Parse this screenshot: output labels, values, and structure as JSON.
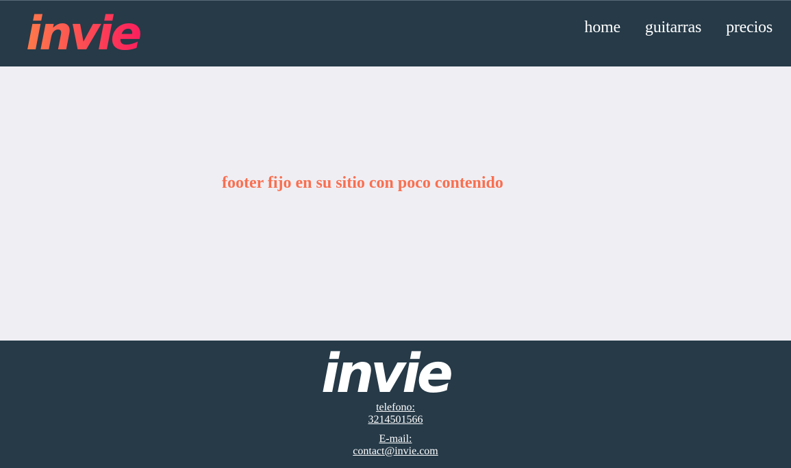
{
  "brand": {
    "name": "invie",
    "header_logo_gradient": [
      "#fd7a4a",
      "#fb1f5d"
    ],
    "footer_logo_color": "#ffffff"
  },
  "nav": {
    "items": [
      {
        "label": "home"
      },
      {
        "label": "guitarras"
      },
      {
        "label": "precios"
      }
    ]
  },
  "main": {
    "message": "footer fijo en su sitio con poco contenido"
  },
  "footer": {
    "phone_label": "telefono:",
    "phone_value": "3214501566",
    "email_label": "E-mail:",
    "email_value": "contact@invie.com"
  },
  "colors": {
    "header_bg": "#263a48",
    "page_bg": "#efeef3",
    "accent": "#f96f50",
    "nav_text": "#ffffff"
  }
}
